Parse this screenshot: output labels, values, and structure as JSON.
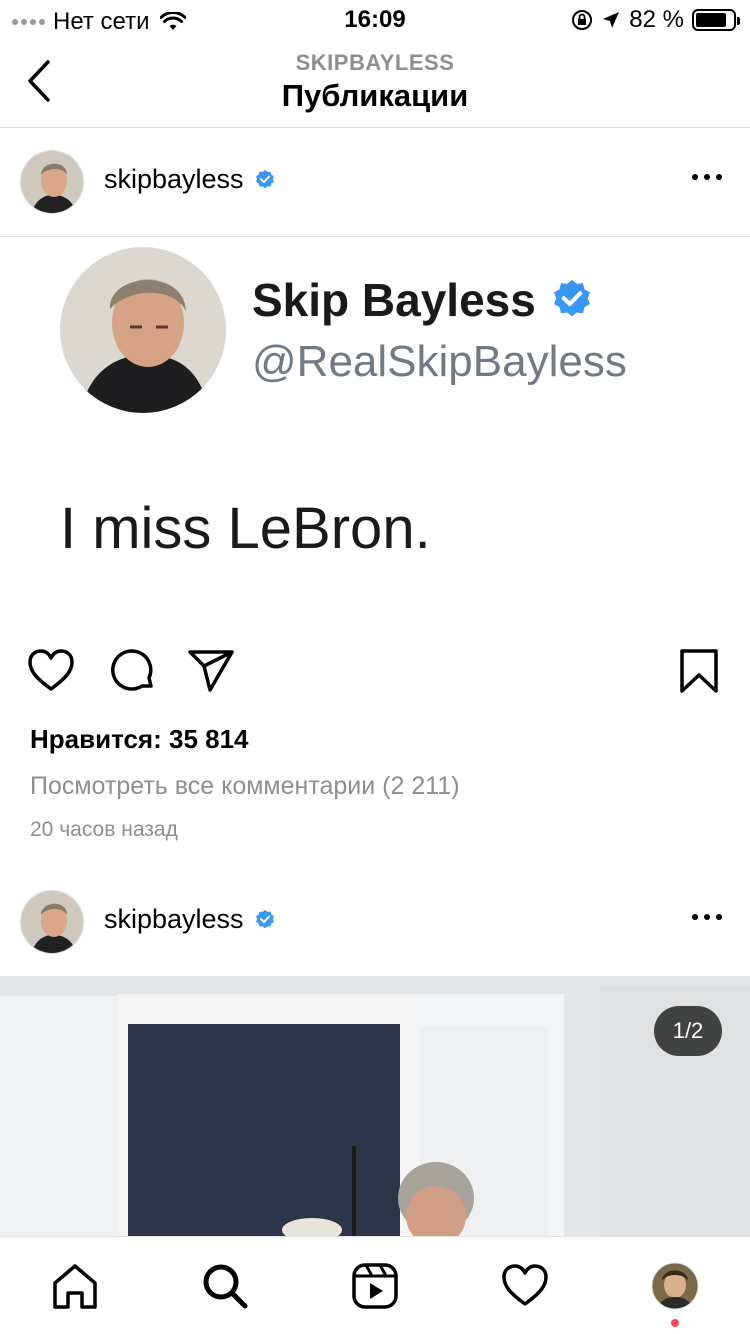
{
  "status_bar": {
    "carrier": "Нет сети",
    "time": "16:09",
    "battery_text": "82 %",
    "battery_level": 0.82
  },
  "header": {
    "subtitle": "SKIPBAYLESS",
    "title": "Публикации"
  },
  "posts": [
    {
      "username": "skipbayless",
      "verified": true,
      "tweet": {
        "name": "Skip Bayless",
        "handle": "@RealSkipBayless",
        "text": "I miss LeBron."
      },
      "likes": "Нравится: 35 814",
      "comments_link": "Посмотреть все комментарии (2 211)",
      "time": "20 часов назад"
    },
    {
      "username": "skipbayless",
      "verified": true,
      "carousel_counter": "1/2"
    }
  ],
  "tab_bar": {
    "items": [
      "home-icon",
      "search-icon",
      "reels-icon",
      "heart-icon",
      "profile-avatar"
    ]
  },
  "colors": {
    "verified_blue": "#3897f0",
    "notification_red": "#ed4956",
    "muted_text": "#8e8e8e"
  }
}
